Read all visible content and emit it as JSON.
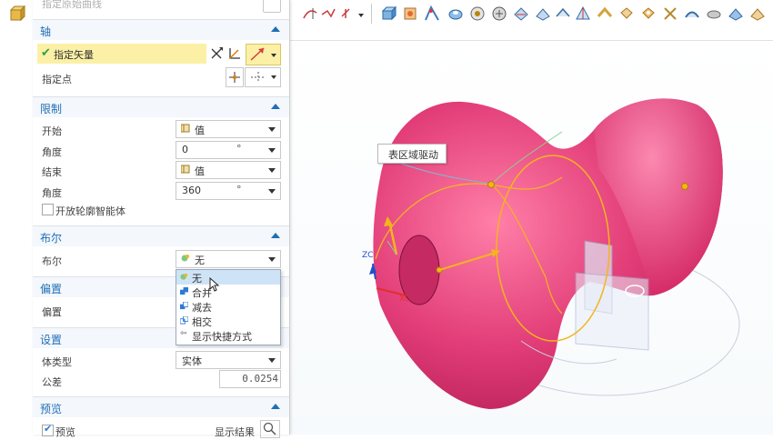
{
  "panel": {
    "top_partial_label": "指定原始曲线",
    "axis": {
      "title": "轴",
      "specify_vector": "指定矢量",
      "specify_point": "指定点"
    },
    "limits": {
      "title": "限制",
      "start_label": "开始",
      "start_value": "值",
      "start_angle_label": "角度",
      "start_angle_value": "0",
      "start_angle_unit": "°",
      "end_label": "结束",
      "end_value": "值",
      "end_angle_label": "角度",
      "end_angle_value": "360",
      "end_angle_unit": "°",
      "open_profile_label": "开放轮廓智能体"
    },
    "boolean": {
      "title": "布尔",
      "label": "布尔",
      "value": "无",
      "options": [
        "无",
        "合并",
        "减去",
        "相交",
        "显示快捷方式"
      ]
    },
    "offset": {
      "title": "偏置",
      "label": "偏置"
    },
    "settings": {
      "title": "设置",
      "body_type_label": "体类型",
      "body_type_value": "实体",
      "tolerance_label": "公差",
      "tolerance_value": "0.0254"
    },
    "preview": {
      "title": "预览",
      "preview_label": "预览",
      "show_result_label": "显示结果"
    }
  },
  "viewport": {
    "tooltip": "表区域驱动",
    "triad_z": "ZC",
    "triad_x": "XC",
    "surface_color": "#e23d78",
    "curve_color": "#f3b51e"
  },
  "colors": {
    "accent": "#1f6fb8",
    "selected_row": "#fbf0a6"
  }
}
